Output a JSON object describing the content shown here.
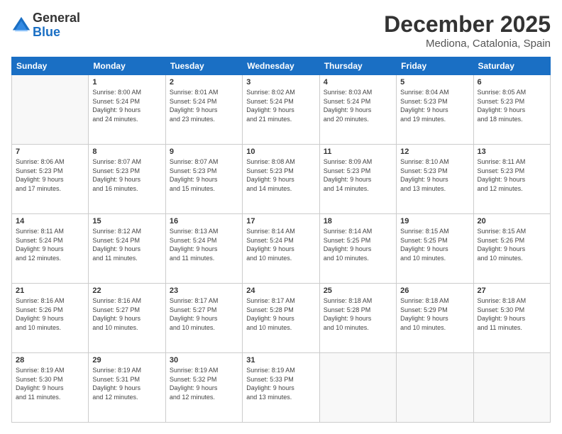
{
  "header": {
    "logo_line1": "General",
    "logo_line2": "Blue",
    "month": "December 2025",
    "location": "Mediona, Catalonia, Spain"
  },
  "weekdays": [
    "Sunday",
    "Monday",
    "Tuesday",
    "Wednesday",
    "Thursday",
    "Friday",
    "Saturday"
  ],
  "weeks": [
    [
      {
        "day": "",
        "info": ""
      },
      {
        "day": "1",
        "info": "Sunrise: 8:00 AM\nSunset: 5:24 PM\nDaylight: 9 hours\nand 24 minutes."
      },
      {
        "day": "2",
        "info": "Sunrise: 8:01 AM\nSunset: 5:24 PM\nDaylight: 9 hours\nand 23 minutes."
      },
      {
        "day": "3",
        "info": "Sunrise: 8:02 AM\nSunset: 5:24 PM\nDaylight: 9 hours\nand 21 minutes."
      },
      {
        "day": "4",
        "info": "Sunrise: 8:03 AM\nSunset: 5:24 PM\nDaylight: 9 hours\nand 20 minutes."
      },
      {
        "day": "5",
        "info": "Sunrise: 8:04 AM\nSunset: 5:23 PM\nDaylight: 9 hours\nand 19 minutes."
      },
      {
        "day": "6",
        "info": "Sunrise: 8:05 AM\nSunset: 5:23 PM\nDaylight: 9 hours\nand 18 minutes."
      }
    ],
    [
      {
        "day": "7",
        "info": "Sunrise: 8:06 AM\nSunset: 5:23 PM\nDaylight: 9 hours\nand 17 minutes."
      },
      {
        "day": "8",
        "info": "Sunrise: 8:07 AM\nSunset: 5:23 PM\nDaylight: 9 hours\nand 16 minutes."
      },
      {
        "day": "9",
        "info": "Sunrise: 8:07 AM\nSunset: 5:23 PM\nDaylight: 9 hours\nand 15 minutes."
      },
      {
        "day": "10",
        "info": "Sunrise: 8:08 AM\nSunset: 5:23 PM\nDaylight: 9 hours\nand 14 minutes."
      },
      {
        "day": "11",
        "info": "Sunrise: 8:09 AM\nSunset: 5:23 PM\nDaylight: 9 hours\nand 14 minutes."
      },
      {
        "day": "12",
        "info": "Sunrise: 8:10 AM\nSunset: 5:23 PM\nDaylight: 9 hours\nand 13 minutes."
      },
      {
        "day": "13",
        "info": "Sunrise: 8:11 AM\nSunset: 5:23 PM\nDaylight: 9 hours\nand 12 minutes."
      }
    ],
    [
      {
        "day": "14",
        "info": "Sunrise: 8:11 AM\nSunset: 5:24 PM\nDaylight: 9 hours\nand 12 minutes."
      },
      {
        "day": "15",
        "info": "Sunrise: 8:12 AM\nSunset: 5:24 PM\nDaylight: 9 hours\nand 11 minutes."
      },
      {
        "day": "16",
        "info": "Sunrise: 8:13 AM\nSunset: 5:24 PM\nDaylight: 9 hours\nand 11 minutes."
      },
      {
        "day": "17",
        "info": "Sunrise: 8:14 AM\nSunset: 5:24 PM\nDaylight: 9 hours\nand 10 minutes."
      },
      {
        "day": "18",
        "info": "Sunrise: 8:14 AM\nSunset: 5:25 PM\nDaylight: 9 hours\nand 10 minutes."
      },
      {
        "day": "19",
        "info": "Sunrise: 8:15 AM\nSunset: 5:25 PM\nDaylight: 9 hours\nand 10 minutes."
      },
      {
        "day": "20",
        "info": "Sunrise: 8:15 AM\nSunset: 5:26 PM\nDaylight: 9 hours\nand 10 minutes."
      }
    ],
    [
      {
        "day": "21",
        "info": "Sunrise: 8:16 AM\nSunset: 5:26 PM\nDaylight: 9 hours\nand 10 minutes."
      },
      {
        "day": "22",
        "info": "Sunrise: 8:16 AM\nSunset: 5:27 PM\nDaylight: 9 hours\nand 10 minutes."
      },
      {
        "day": "23",
        "info": "Sunrise: 8:17 AM\nSunset: 5:27 PM\nDaylight: 9 hours\nand 10 minutes."
      },
      {
        "day": "24",
        "info": "Sunrise: 8:17 AM\nSunset: 5:28 PM\nDaylight: 9 hours\nand 10 minutes."
      },
      {
        "day": "25",
        "info": "Sunrise: 8:18 AM\nSunset: 5:28 PM\nDaylight: 9 hours\nand 10 minutes."
      },
      {
        "day": "26",
        "info": "Sunrise: 8:18 AM\nSunset: 5:29 PM\nDaylight: 9 hours\nand 10 minutes."
      },
      {
        "day": "27",
        "info": "Sunrise: 8:18 AM\nSunset: 5:30 PM\nDaylight: 9 hours\nand 11 minutes."
      }
    ],
    [
      {
        "day": "28",
        "info": "Sunrise: 8:19 AM\nSunset: 5:30 PM\nDaylight: 9 hours\nand 11 minutes."
      },
      {
        "day": "29",
        "info": "Sunrise: 8:19 AM\nSunset: 5:31 PM\nDaylight: 9 hours\nand 12 minutes."
      },
      {
        "day": "30",
        "info": "Sunrise: 8:19 AM\nSunset: 5:32 PM\nDaylight: 9 hours\nand 12 minutes."
      },
      {
        "day": "31",
        "info": "Sunrise: 8:19 AM\nSunset: 5:33 PM\nDaylight: 9 hours\nand 13 minutes."
      },
      {
        "day": "",
        "info": ""
      },
      {
        "day": "",
        "info": ""
      },
      {
        "day": "",
        "info": ""
      }
    ]
  ]
}
